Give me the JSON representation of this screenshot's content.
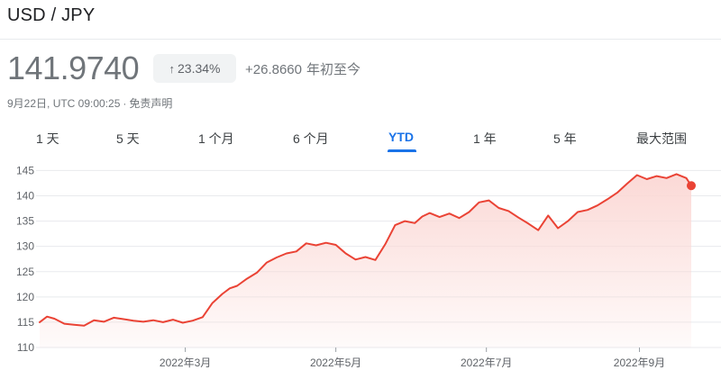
{
  "header": {
    "pair": "USD / JPY",
    "price": "141.9740",
    "percent_change": "23.34%",
    "change": "+26.8660",
    "change_suffix": "年初至今",
    "timestamp": "9月22日, UTC 09:00:25",
    "separator": "·",
    "disclaimer": "免责声明"
  },
  "tabs": [
    {
      "label": "1 天"
    },
    {
      "label": "5 天"
    },
    {
      "label": "1 个月"
    },
    {
      "label": "6 个月"
    },
    {
      "label": "YTD",
      "active": true
    },
    {
      "label": "1 年"
    },
    {
      "label": "5 年"
    },
    {
      "label": "最大范围"
    }
  ],
  "colors": {
    "line": "#ea4335",
    "fill": "#fbd9d6",
    "active_tab": "#1a73e8",
    "grid": "#e8eaed"
  },
  "icons": {
    "percent_arrow": "arrow-up-icon"
  },
  "chart_data": {
    "type": "area",
    "y_ticks": [
      110,
      115,
      120,
      125,
      130,
      135,
      140,
      145
    ],
    "ylim": [
      110,
      146.5
    ],
    "x_ticks": [
      {
        "label": "2022年3月",
        "day": 59
      },
      {
        "label": "2022年5月",
        "day": 120
      },
      {
        "label": "2022年7月",
        "day": 181
      },
      {
        "label": "2022年9月",
        "day": 243
      }
    ],
    "x_range_days": [
      0,
      264
    ],
    "grid": true,
    "series": [
      {
        "days": [
          0,
          3,
          6,
          10,
          14,
          18,
          22,
          26,
          30,
          34,
          38,
          42,
          46,
          50,
          54,
          58,
          62,
          66,
          70,
          74,
          77,
          80,
          84,
          88,
          92,
          96,
          100,
          104,
          108,
          112,
          116,
          120,
          124,
          128,
          132,
          136,
          140,
          144,
          148,
          152,
          155,
          158,
          162,
          166,
          170,
          174,
          178,
          182,
          186,
          190,
          194,
          198,
          202,
          206,
          210,
          214,
          218,
          222,
          226,
          230,
          234,
          238,
          242,
          246,
          250,
          254,
          258,
          262,
          264
        ],
        "values": [
          115.0,
          116.1,
          115.7,
          114.7,
          114.5,
          114.3,
          115.4,
          115.1,
          115.9,
          115.6,
          115.3,
          115.1,
          115.4,
          115.0,
          115.5,
          114.9,
          115.3,
          116.0,
          118.8,
          120.6,
          121.7,
          122.2,
          123.6,
          124.8,
          126.8,
          127.8,
          128.6,
          129.0,
          130.6,
          130.2,
          130.7,
          130.3,
          128.6,
          127.4,
          127.9,
          127.3,
          130.4,
          134.2,
          135.0,
          134.6,
          135.9,
          136.6,
          135.8,
          136.5,
          135.6,
          136.8,
          138.7,
          139.1,
          137.6,
          137.0,
          135.7,
          134.5,
          133.2,
          136.1,
          133.6,
          135.0,
          136.8,
          137.2,
          138.1,
          139.3,
          140.6,
          142.4,
          144.1,
          143.3,
          143.9,
          143.5,
          144.3,
          143.5,
          142.0
        ]
      }
    ]
  }
}
